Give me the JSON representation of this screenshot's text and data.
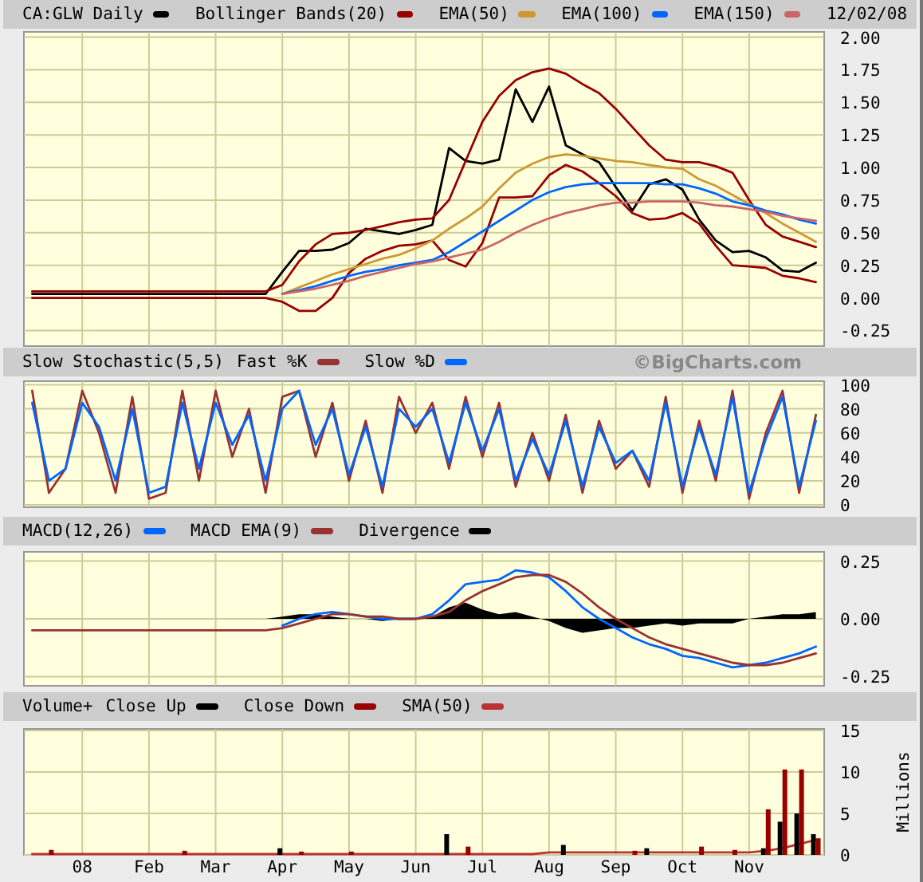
{
  "panels": [
    {
      "date": "12/02/08",
      "chart_data": {
        "type": "line",
        "grid": true,
        "categories": [
          null,
          null,
          null,
          null,
          null,
          null,
          null,
          null,
          null,
          null,
          null,
          null,
          null,
          null,
          null,
          null,
          null,
          null,
          null,
          null,
          null,
          null,
          null,
          null,
          null,
          null,
          null,
          null,
          null,
          null,
          null,
          null,
          null,
          null,
          null,
          null,
          null,
          null,
          null,
          null,
          null,
          null,
          null,
          null,
          null,
          null,
          null,
          null
        ],
        "ylim": [
          -0.37,
          2.04
        ],
        "yticks": [
          {
            "value": -0.25,
            "label": "-0.25"
          },
          {
            "value": 0,
            "label": "0.00"
          },
          {
            "value": 0.25,
            "label": "0.25"
          },
          {
            "value": 0.5,
            "label": "0.50"
          },
          {
            "value": 0.75,
            "label": "0.75"
          },
          {
            "value": 1,
            "label": "1.00"
          },
          {
            "value": 1.25,
            "label": "1.25"
          },
          {
            "value": 1.5,
            "label": "1.50"
          },
          {
            "value": 1.75,
            "label": "1.75"
          },
          {
            "value": 2,
            "label": "2.00"
          }
        ],
        "series": [
          {
            "name": "CA:GLW Daily",
            "color": "#000000",
            "values": [
              0.03,
              0.03,
              0.03,
              0.03,
              0.03,
              0.03,
              0.03,
              0.03,
              0.03,
              0.03,
              0.03,
              0.03,
              0.03,
              0.03,
              0.03,
              0.2,
              0.36,
              0.36,
              0.37,
              0.42,
              0.53,
              0.51,
              0.49,
              0.52,
              0.56,
              1.15,
              1.05,
              1.03,
              1.06,
              1.6,
              1.35,
              1.62,
              1.17,
              1.1,
              1.04,
              0.85,
              0.67,
              0.87,
              0.91,
              0.83,
              0.6,
              0.44,
              0.35,
              0.36,
              0.31,
              0.21,
              0.2,
              0.27
            ]
          },
          {
            "name": "Bollinger Bands(20)",
            "color": "#990000",
            "values": [
              0.05,
              0.05,
              0.05,
              0.05,
              0.05,
              0.05,
              0.05,
              0.05,
              0.05,
              0.05,
              0.05,
              0.05,
              0.05,
              0.05,
              0.05,
              0.1,
              0.28,
              0.41,
              0.49,
              0.5,
              0.52,
              0.55,
              0.58,
              0.6,
              0.61,
              0.75,
              1.05,
              1.35,
              1.55,
              1.67,
              1.73,
              1.76,
              1.72,
              1.64,
              1.57,
              1.45,
              1.31,
              1.17,
              1.06,
              1.04,
              1.04,
              1.01,
              0.96,
              0.75,
              0.56,
              0.47,
              0.43,
              0.39
            ]
          },
          {
            "color": "#990000",
            "values": [
              0.0,
              0.0,
              0.0,
              0.0,
              0.0,
              0.0,
              0.0,
              0.0,
              0.0,
              0.0,
              0.0,
              0.0,
              0.0,
              0.0,
              0.0,
              -0.03,
              -0.1,
              -0.1,
              0.0,
              0.19,
              0.3,
              0.36,
              0.4,
              0.41,
              0.44,
              0.29,
              0.24,
              0.42,
              0.77,
              0.77,
              0.78,
              0.94,
              1.02,
              0.97,
              0.88,
              0.78,
              0.65,
              0.6,
              0.61,
              0.65,
              0.57,
              0.4,
              0.25,
              0.24,
              0.23,
              0.17,
              0.15,
              0.12
            ]
          },
          {
            "name": "EMA(50)",
            "color": "#cc9933",
            "values": [
              null,
              null,
              null,
              null,
              null,
              null,
              null,
              null,
              null,
              null,
              null,
              null,
              null,
              null,
              null,
              0.03,
              0.08,
              0.13,
              0.18,
              0.22,
              0.26,
              0.3,
              0.33,
              0.38,
              0.44,
              0.53,
              0.61,
              0.7,
              0.84,
              0.96,
              1.03,
              1.08,
              1.1,
              1.09,
              1.07,
              1.05,
              1.04,
              1.02,
              1.0,
              0.99,
              0.91,
              0.86,
              0.79,
              0.72,
              0.65,
              0.57,
              0.5,
              0.43
            ]
          },
          {
            "name": "EMA(100)",
            "color": "#0066ff",
            "values": [
              null,
              null,
              null,
              null,
              null,
              null,
              null,
              null,
              null,
              null,
              null,
              null,
              null,
              null,
              null,
              0.03,
              0.06,
              0.09,
              0.13,
              0.17,
              0.2,
              0.22,
              0.25,
              0.27,
              0.29,
              0.35,
              0.43,
              0.51,
              0.59,
              0.67,
              0.75,
              0.81,
              0.85,
              0.87,
              0.88,
              0.88,
              0.88,
              0.88,
              0.87,
              0.87,
              0.84,
              0.8,
              0.74,
              0.71,
              0.67,
              0.64,
              0.6,
              0.57
            ]
          },
          {
            "name": "EMA(150)",
            "color": "#cc6666",
            "values": [
              null,
              null,
              null,
              null,
              null,
              null,
              null,
              null,
              null,
              null,
              null,
              null,
              null,
              null,
              null,
              0.03,
              0.05,
              0.07,
              0.1,
              0.13,
              0.17,
              0.2,
              0.23,
              0.26,
              0.28,
              0.31,
              0.34,
              0.37,
              0.43,
              0.5,
              0.56,
              0.61,
              0.65,
              0.68,
              0.71,
              0.73,
              0.73,
              0.74,
              0.74,
              0.74,
              0.73,
              0.71,
              0.7,
              0.68,
              0.66,
              0.63,
              0.61,
              0.59
            ]
          }
        ]
      }
    },
    {
      "title": "Slow Stochastic(5,5)",
      "credit": "©BigCharts.com",
      "chart_data": {
        "type": "line",
        "grid": true,
        "categories": [
          null,
          null,
          null,
          null,
          null,
          null,
          null,
          null,
          null,
          null,
          null,
          null,
          null,
          null,
          null,
          null,
          null,
          null,
          null,
          null,
          null,
          null,
          null,
          null,
          null,
          null,
          null,
          null,
          null,
          null,
          null,
          null,
          null,
          null,
          null,
          null,
          null,
          null,
          null,
          null,
          null,
          null,
          null,
          null,
          null,
          null,
          null,
          null
        ],
        "ylim": [
          -2,
          103
        ],
        "yticks": [
          0,
          20,
          40,
          60,
          80,
          100
        ],
        "series": [
          {
            "name": "Fast %K",
            "color": "#993333",
            "values": [
              95,
              10,
              30,
              95,
              60,
              10,
              90,
              5,
              10,
              95,
              20,
              95,
              40,
              80,
              10,
              90,
              95,
              40,
              85,
              20,
              70,
              10,
              90,
              60,
              85,
              30,
              90,
              40,
              85,
              15,
              60,
              20,
              75,
              10,
              70,
              30,
              45,
              15,
              90,
              10,
              70,
              20,
              95,
              5,
              60,
              95,
              10,
              75
            ]
          },
          {
            "name": "Slow %D",
            "color": "#0066ff",
            "values": [
              85,
              20,
              30,
              85,
              65,
              20,
              80,
              10,
              15,
              85,
              30,
              85,
              50,
              75,
              20,
              80,
              95,
              50,
              80,
              25,
              65,
              15,
              80,
              65,
              80,
              35,
              85,
              45,
              80,
              20,
              55,
              25,
              70,
              15,
              65,
              35,
              45,
              20,
              85,
              15,
              65,
              25,
              90,
              10,
              55,
              90,
              15,
              70
            ]
          }
        ]
      }
    },
    {
      "chart_data": {
        "type": "line",
        "grid": true,
        "categories": [
          null,
          null,
          null,
          null,
          null,
          null,
          null,
          null,
          null,
          null,
          null,
          null,
          null,
          null,
          null,
          null,
          null,
          null,
          null,
          null,
          null,
          null,
          null,
          null,
          null,
          null,
          null,
          null,
          null,
          null,
          null,
          null,
          null,
          null,
          null,
          null,
          null,
          null,
          null,
          null,
          null,
          null,
          null,
          null,
          null,
          null,
          null,
          null
        ],
        "ylim": [
          -0.29,
          0.29
        ],
        "yticks": [
          {
            "value": -0.25,
            "label": "-0.25"
          },
          {
            "value": 0,
            "label": "0.00"
          },
          {
            "value": 0.25,
            "label": "0.25"
          }
        ],
        "series": [
          {
            "name": "MACD(12,26)",
            "color": "#0066ff",
            "values": [
              null,
              null,
              null,
              null,
              null,
              null,
              null,
              null,
              null,
              null,
              null,
              null,
              null,
              null,
              null,
              -0.03,
              0.0,
              0.02,
              0.03,
              0.02,
              0.01,
              0.0,
              0.0,
              0.0,
              0.02,
              0.08,
              0.15,
              0.16,
              0.17,
              0.21,
              0.2,
              0.18,
              0.12,
              0.05,
              0.0,
              -0.04,
              -0.08,
              -0.11,
              -0.13,
              -0.16,
              -0.17,
              -0.19,
              -0.21,
              -0.2,
              -0.19,
              -0.17,
              -0.15,
              -0.12
            ]
          },
          {
            "name": "MACD EMA(9)",
            "color": "#993333",
            "values": [
              -0.05,
              -0.05,
              -0.05,
              -0.05,
              -0.05,
              -0.05,
              -0.05,
              -0.05,
              -0.05,
              -0.05,
              -0.05,
              -0.05,
              -0.05,
              -0.05,
              -0.05,
              -0.04,
              -0.02,
              0.0,
              0.02,
              0.02,
              0.01,
              0.01,
              0.0,
              0.0,
              0.01,
              0.03,
              0.08,
              0.12,
              0.15,
              0.18,
              0.19,
              0.19,
              0.16,
              0.11,
              0.05,
              0.0,
              -0.04,
              -0.08,
              -0.11,
              -0.13,
              -0.15,
              -0.17,
              -0.19,
              -0.2,
              -0.2,
              -0.19,
              -0.17,
              -0.15
            ]
          },
          {
            "name": "Divergence",
            "type": "area",
            "color": "#000000",
            "values": [
              0,
              0,
              0,
              0,
              0,
              0,
              0,
              0,
              0,
              0,
              0,
              0,
              0,
              0,
              0,
              0.01,
              0.02,
              0.02,
              0.01,
              0,
              0,
              -0.01,
              0,
              0,
              0.01,
              0.05,
              0.07,
              0.04,
              0.02,
              0.03,
              0.01,
              -0.01,
              -0.04,
              -0.06,
              -0.05,
              -0.04,
              -0.04,
              -0.03,
              -0.02,
              -0.03,
              -0.02,
              -0.02,
              -0.02,
              0.0,
              0.01,
              0.02,
              0.02,
              0.03
            ]
          }
        ]
      }
    },
    {
      "title": "Volume+",
      "chart_data": {
        "type": "bar",
        "grid": true,
        "ylabel": "Millions",
        "categories": [
          null,
          null,
          null,
          "08",
          null,
          null,
          null,
          "Feb",
          null,
          null,
          null,
          "Mar",
          null,
          null,
          null,
          "Apr",
          null,
          null,
          null,
          "May",
          null,
          null,
          null,
          "Jun",
          null,
          null,
          null,
          "Jul",
          null,
          null,
          null,
          "Aug",
          null,
          null,
          null,
          "Sep",
          null,
          null,
          null,
          "Oct",
          null,
          null,
          null,
          "Nov",
          null,
          null,
          null,
          null
        ],
        "ylim": [
          0,
          15.2
        ],
        "yticks": [
          0,
          5,
          10,
          15
        ],
        "series": [
          {
            "name": "Close Up",
            "color": "#000000",
            "values": [
              null,
              null,
              null,
              null,
              null,
              null,
              null,
              null,
              null,
              null,
              null,
              null,
              null,
              null,
              null,
              0.8,
              null,
              null,
              null,
              null,
              null,
              null,
              null,
              null,
              null,
              2.5,
              null,
              null,
              null,
              null,
              null,
              null,
              1.2,
              null,
              null,
              null,
              null,
              0.8,
              null,
              null,
              null,
              null,
              null,
              null,
              0.8,
              4.0,
              5.0,
              2.5
            ]
          },
          {
            "name": "Close Down",
            "color": "#990000",
            "values": [
              null,
              0.6,
              null,
              null,
              null,
              null,
              null,
              null,
              null,
              0.5,
              null,
              null,
              null,
              null,
              null,
              null,
              0.4,
              null,
              null,
              0.4,
              null,
              null,
              null,
              null,
              null,
              null,
              1.0,
              null,
              null,
              null,
              null,
              null,
              null,
              null,
              null,
              null,
              0.5,
              null,
              null,
              null,
              1.0,
              null,
              0.6,
              null,
              5.5,
              10.3,
              10.3,
              2.0
            ]
          },
          {
            "name": "SMA(50)",
            "type": "line",
            "color": "#bb3333",
            "values": [
              0.1,
              0.1,
              0.1,
              0.1,
              0.1,
              0.1,
              0.1,
              0.1,
              0.1,
              0.1,
              0.1,
              0.1,
              0.1,
              0.1,
              0.1,
              0.1,
              0.1,
              0.1,
              0.1,
              0.1,
              0.1,
              0.1,
              0.1,
              0.1,
              0.1,
              0.1,
              0.1,
              0.1,
              0.1,
              0.1,
              0.1,
              0.3,
              0.3,
              0.3,
              0.3,
              0.3,
              0.3,
              0.3,
              0.3,
              0.3,
              0.3,
              0.3,
              0.3,
              0.3,
              0.5,
              0.8,
              1.3,
              1.8
            ]
          }
        ]
      }
    }
  ]
}
